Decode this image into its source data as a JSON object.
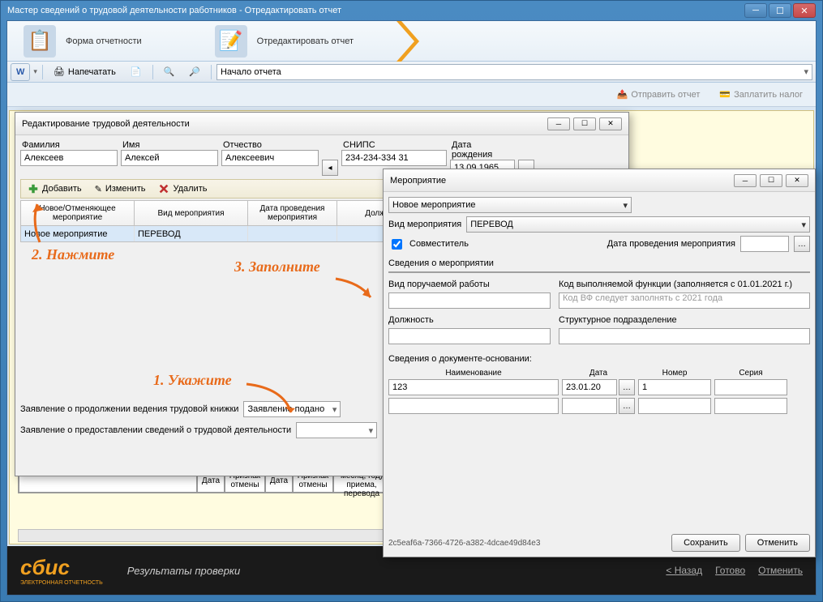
{
  "window": {
    "title": "Мастер сведений о трудовой деятельности работников - Отредактировать отчет"
  },
  "wizard": {
    "step1": "Форма отчетности",
    "step2": "Отредактировать отчет"
  },
  "toolbar": {
    "print": "Напечатать",
    "combo": "Начало отчета"
  },
  "sub_toolbar": {
    "send_report": "Отправить отчет",
    "pay_tax": "Заплатить налог"
  },
  "edit_modal": {
    "title": "Редактирование трудовой деятельности",
    "labels": {
      "surname": "Фамилия",
      "name": "Имя",
      "patronymic": "Отчество",
      "snils": "СНИПС",
      "birthdate": "Дата рождения"
    },
    "values": {
      "surname": "Алексеев",
      "name": "Алексей",
      "patronymic": "Алексеевич",
      "snils": "234-234-334 31",
      "birthdate": "13.09.1965"
    },
    "actions": {
      "add": "Добавить",
      "edit": "Изменить",
      "delete": "Удалить"
    },
    "grid": {
      "col1": "Новое/Отменяющее мероприятие",
      "col2": "Вид мероприятия",
      "col3": "Дата проведения мероприятия",
      "col4": "Должность"
    },
    "row": {
      "c1": "Новое мероприятие",
      "c2": "ПЕРЕВОД"
    },
    "bottom": {
      "statement1_label": "Заявление о продолжении ведения трудовой книжки",
      "statement1_value": "Заявление подано",
      "statement2_label": "Заявление о предоставлении сведений о трудовой деятельности"
    }
  },
  "annotations": {
    "a1": "1. Укажите",
    "a2": "2. Нажмите",
    "a3": "3. Заполните"
  },
  "event_modal": {
    "title": "Мероприятие",
    "new_event": "Новое мероприятие",
    "type_label": "Вид мероприятия",
    "type_value": "ПЕРЕВОД",
    "combined": "Совместитель",
    "date_label": "Дата проведения мероприятия",
    "info_label": "Сведения о мероприятии",
    "work_type_label": "Вид поручаемой работы",
    "func_code_label": "Код выполняемой функции (заполняется с 01.01.2021 г.)",
    "func_code_placeholder": "Код ВФ следует заполнять с 2021 года",
    "position_label": "Должность",
    "unit_label": "Структурное подразделение",
    "doc_section": "Сведения о документе-основании:",
    "doc_cols": {
      "name": "Наименование",
      "date": "Дата",
      "number": "Номер",
      "series": "Серия"
    },
    "doc_row": {
      "name": "123",
      "date": "23.01.20",
      "number": "1",
      "series": ""
    },
    "guid": "2c5eaf6a-7366-4726-a382-4dcae49d84e3",
    "save": "Сохранить",
    "cancel": "Отменить"
  },
  "back_table": {
    "h1": "Дата",
    "h2": "Признак отмены",
    "h3": "Дата",
    "h4": "Признак отмены",
    "h5": "(число, месяц, год) приема, перевода"
  },
  "footer": {
    "logo": "сбис",
    "logo_sub": "ЭЛЕКТРОННАЯ ОТЧЕТНОСТЬ",
    "text": "Результаты проверки",
    "back": "< Назад",
    "done": "Готово",
    "cancel": "Отменить"
  }
}
